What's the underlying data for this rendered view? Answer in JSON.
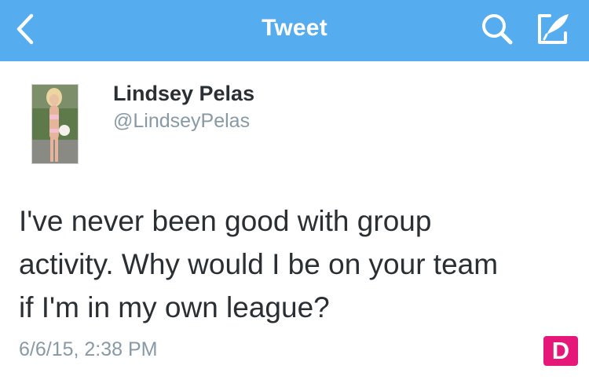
{
  "navbar": {
    "title": "Tweet",
    "back_icon": "chevron-left-icon",
    "search_icon": "search-icon",
    "compose_icon": "compose-icon",
    "background_color": "#55acee"
  },
  "tweet": {
    "author_name": "Lindsey Pelas",
    "author_handle": "@LindseyPelas",
    "text_lines": [
      "I've never been good with group",
      "activity. Why would I be on your team",
      "if I'm in my own league?"
    ],
    "timestamp": "6/6/15, 2:38 PM"
  },
  "badge": {
    "label": "D",
    "color": "#e5187a"
  }
}
